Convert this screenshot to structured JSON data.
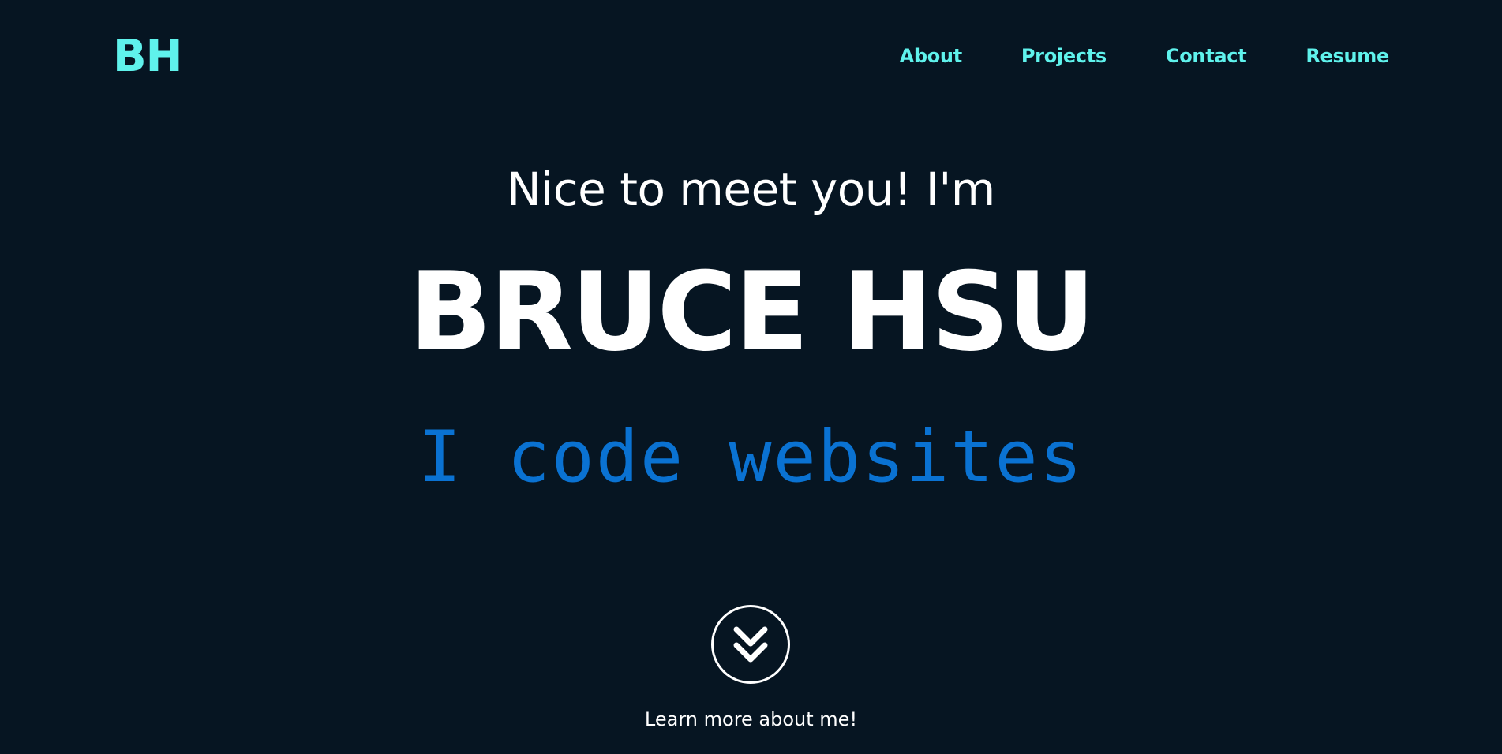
{
  "header": {
    "logo_text": "BH",
    "nav": [
      {
        "label": "About"
      },
      {
        "label": "Projects"
      },
      {
        "label": "Contact"
      },
      {
        "label": "Resume"
      }
    ]
  },
  "hero": {
    "greeting": "Nice to meet you! I'm",
    "name": "BRUCE HSU",
    "tagline": "I code websites",
    "scroll_icon": "double-chevron-down-icon",
    "learn_more": "Learn more about me!"
  },
  "colors": {
    "background": "#061522",
    "accent": "#5ff2ec",
    "tagline": "#0a72d2",
    "text": "#ffffff"
  }
}
